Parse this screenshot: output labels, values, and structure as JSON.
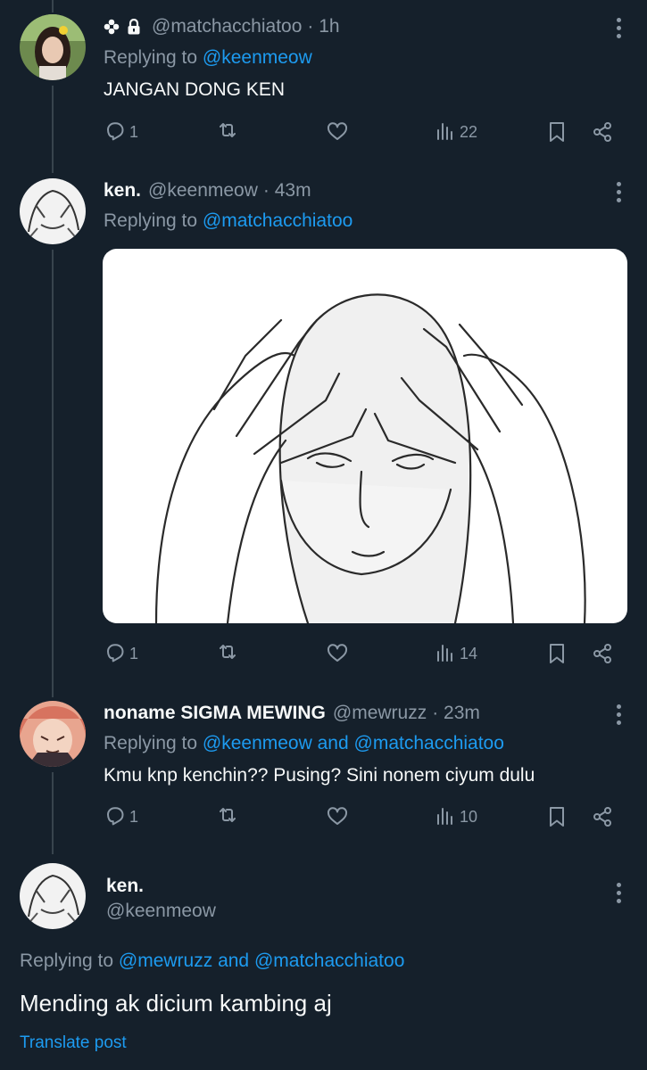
{
  "tweets": [
    {
      "badge_icons": [
        "flower-icon",
        "lock-icon"
      ],
      "handle": "@matchacchiatoo",
      "time": "· 1h",
      "replying_prefix": "Replying to",
      "replying_to": "@keenmeow",
      "text": "JANGAN DONG KEN",
      "stats": {
        "replies": "1",
        "views": "22"
      }
    },
    {
      "name": "ken.",
      "handle": "@keenmeow",
      "time": "· 43m",
      "replying_prefix": "Replying to",
      "replying_to": "@matchacchiatoo",
      "stats": {
        "replies": "1",
        "views": "14"
      }
    },
    {
      "name": "noname SIGMA MEWING",
      "handle": "@mewruzz",
      "time": "· 23m",
      "replying_prefix": "Replying to",
      "replying_to_1": "@keenmeow",
      "replying_and": "and",
      "replying_to_2": "@matchacchiatoo",
      "text": "Kmu knp kenchin?? Pusing? Sini nonem ciyum dulu",
      "stats": {
        "replies": "1",
        "views": "10"
      }
    }
  ],
  "focused": {
    "name": "ken.",
    "handle": "@keenmeow",
    "replying_prefix": "Replying to",
    "replying_to_1": "@mewruzz",
    "replying_and": "and",
    "replying_to_2": "@matchacchiatoo",
    "text": "Mending ak dicium kambing aj",
    "translate": "Translate post"
  },
  "colors": {
    "background": "#15202b",
    "accent": "#1d9bf0",
    "muted": "#8b98a5"
  }
}
